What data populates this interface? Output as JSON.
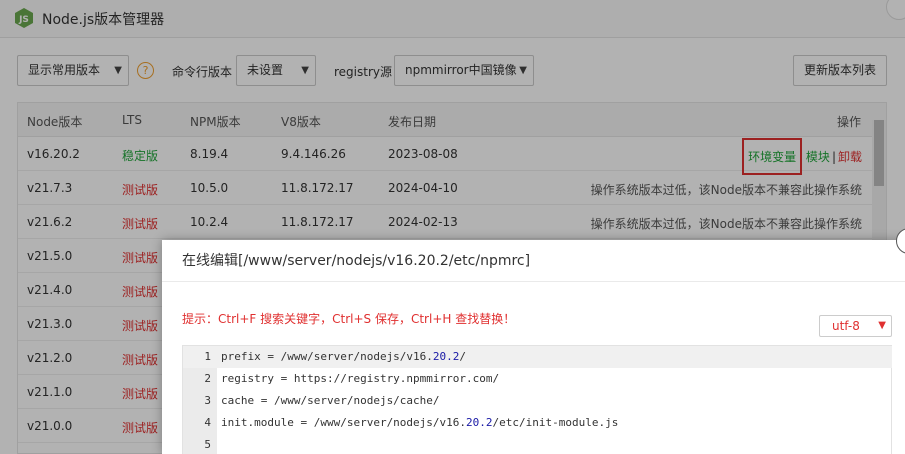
{
  "window": {
    "title": "Node.js版本管理器"
  },
  "toolbar": {
    "filter_select": "显示常用版本",
    "help_icon": "?",
    "cli_label": "命令行版本",
    "cli_select": "未设置",
    "registry_label": "registry源",
    "registry_select": "npmmirror中国镜像",
    "refresh_button": "更新版本列表"
  },
  "table": {
    "headers": [
      "Node版本",
      "LTS",
      "NPM版本",
      "V8版本",
      "发布日期",
      "操作"
    ],
    "rows": [
      {
        "version": "v16.20.2",
        "lts": "稳定版",
        "npm": "8.19.4",
        "v8": "9.4.146.26",
        "date": "2023-08-08",
        "env": "环境变量",
        "module": "模块",
        "sep": "|",
        "uninstall": "卸载"
      },
      {
        "version": "v21.7.3",
        "lts": "测试版",
        "npm": "10.5.0",
        "v8": "11.8.172.17",
        "date": "2024-04-10",
        "note": "操作系统版本过低，该Node版本不兼容此操作系统"
      },
      {
        "version": "v21.6.2",
        "lts": "测试版",
        "npm": "10.2.4",
        "v8": "11.8.172.17",
        "date": "2024-02-13",
        "note": "操作系统版本过低，该Node版本不兼容此操作系统"
      },
      {
        "version": "v21.5.0",
        "lts": "测试版"
      },
      {
        "version": "v21.4.0",
        "lts": "测试版"
      },
      {
        "version": "v21.3.0",
        "lts": "测试版"
      },
      {
        "version": "v21.2.0",
        "lts": "测试版"
      },
      {
        "version": "v21.1.0",
        "lts": "测试版"
      },
      {
        "version": "v21.0.0",
        "lts": "测试版"
      }
    ]
  },
  "dialog": {
    "title": "在线编辑[/www/server/nodejs/v16.20.2/etc/npmrc]",
    "tip": "提示：Ctrl+F 搜索关键字，Ctrl+S 保存，Ctrl+H 查找替换！",
    "encoding": "utf-8",
    "lines": [
      {
        "n": "1",
        "pre": "prefix = /www/server/nodejs/v16.",
        "num": "20.2",
        "post": "/"
      },
      {
        "n": "2",
        "pre": "registry = https://registry.npmmirror.com/",
        "num": "",
        "post": ""
      },
      {
        "n": "3",
        "pre": "cache = /www/server/nodejs/cache/",
        "num": "",
        "post": ""
      },
      {
        "n": "4",
        "pre": "init.module = /www/server/nodejs/v16.",
        "num": "20.2",
        "post": "/etc/init-module.js"
      },
      {
        "n": "5",
        "pre": "",
        "num": "",
        "post": ""
      }
    ]
  }
}
